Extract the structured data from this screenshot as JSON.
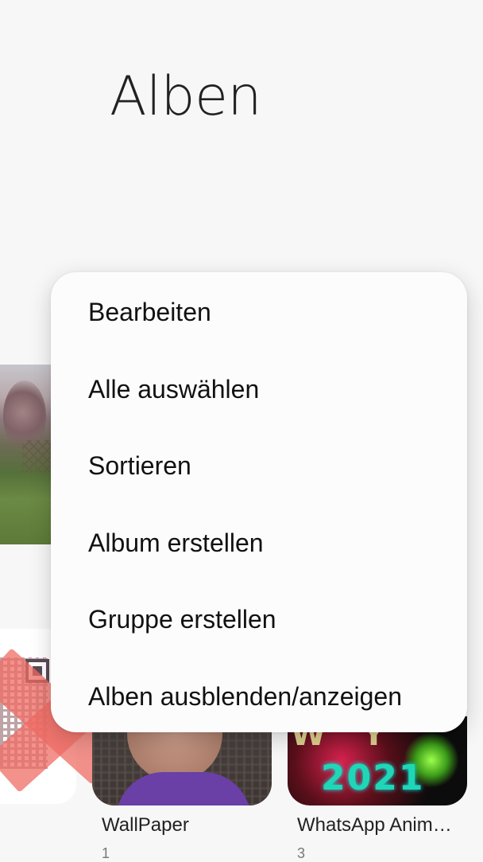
{
  "header": {
    "title": "Alben"
  },
  "albums": [
    {
      "name": "WallPaper",
      "count": "1"
    },
    {
      "name": "WhatsApp Anim…",
      "count": "3"
    }
  ],
  "thumbnails": {
    "whatsapp_year": "2021"
  },
  "menu": {
    "items": [
      {
        "label": "Bearbeiten"
      },
      {
        "label": "Alle auswählen"
      },
      {
        "label": "Sortieren"
      },
      {
        "label": "Album erstellen"
      },
      {
        "label": "Gruppe erstellen"
      },
      {
        "label": "Alben ausblenden/anzeigen"
      }
    ]
  },
  "colors": {
    "background": "#f7f7f7",
    "menu_background": "#fcfcfc",
    "text": "#111111"
  }
}
